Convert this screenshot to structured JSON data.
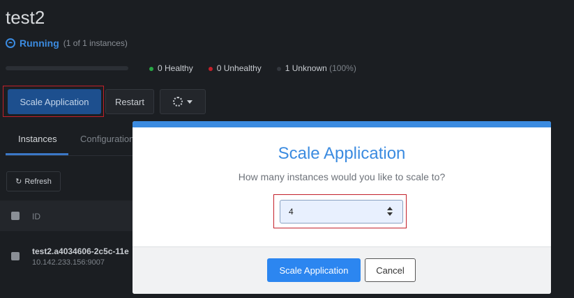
{
  "app": {
    "title": "test2"
  },
  "status": {
    "label": "Running",
    "instances": "(1 of 1 instances)"
  },
  "health": {
    "healthy": "0 Healthy",
    "unhealthy": "0 Unhealthy",
    "unknown": "1 Unknown",
    "unknown_pct": "(100%)",
    "colors": {
      "healthy": "#27a745",
      "unhealthy": "#c3202a",
      "unknown": "#33373d"
    }
  },
  "toolbar": {
    "scale_label": "Scale Application",
    "restart_label": "Restart",
    "settings_icon": "gear-icon"
  },
  "tabs": [
    {
      "label": "Instances"
    },
    {
      "label": "Configuration"
    }
  ],
  "instances": {
    "refresh_label": "Refresh",
    "columns": [
      "ID"
    ],
    "rows": [
      {
        "id": "test2.a4034606-2c5c-11e",
        "address": "10.142.233.156:9007"
      }
    ]
  },
  "modal": {
    "title": "Scale Application",
    "question": "How many instances would you like to scale to?",
    "input_value": "4",
    "primary_label": "Scale Application",
    "cancel_label": "Cancel",
    "accent": "#2c86f0"
  }
}
